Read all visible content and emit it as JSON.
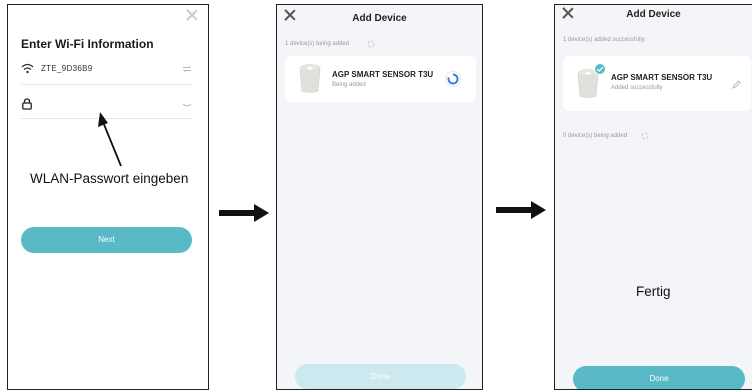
{
  "screen1": {
    "title": "Enter Wi-Fi Information",
    "network_name": "ZTE_9D36B9",
    "password_value": "",
    "next_label": "Next",
    "annotation": "WLAN-Passwort eingeben"
  },
  "screen2": {
    "title": "Add Device",
    "status": "1 device(s) being added",
    "device_name": "AGP SMART SENSOR T3U",
    "device_status": "Being added",
    "button_label": "Done"
  },
  "screen3": {
    "title": "Add Device",
    "status_success": "1 device(s) added successfully",
    "device_name": "AGP SMART SENSOR T3U",
    "device_status": "Added successfully",
    "status_pending": "0 device(s) being added",
    "button_label": "Done",
    "annotation": "Fertig"
  },
  "colors": {
    "accent": "#5ab9c6",
    "accent_disabled": "#cbe9ee",
    "progress_blue": "#3b7de0",
    "screen_bg": "#f4f5f9"
  }
}
